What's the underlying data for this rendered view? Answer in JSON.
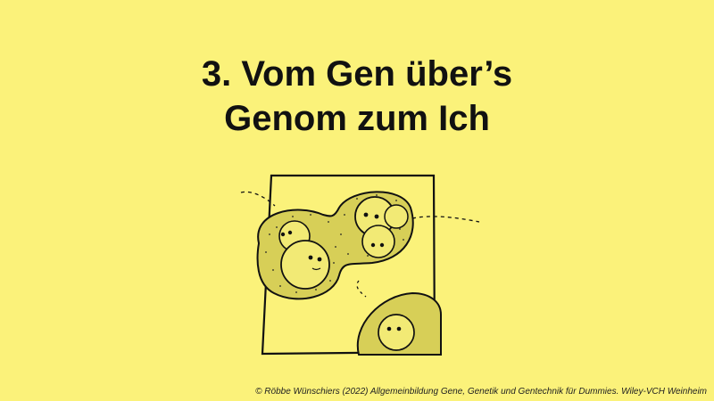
{
  "slide": {
    "title_line1": "3. Vom Gen über’s",
    "title_line2": "Genom zum Ich",
    "footer": "© Röbbe Wünschiers (2022) Allgemeinbildung Gene, Genetik und Gentechnik für Dummies. Wiley-VCH Weinheim"
  },
  "illustration": {
    "subject": "cell-division-illustration",
    "colors": {
      "background": "#fbf27a",
      "ink": "#111111",
      "cytoplasm": "#d7cf57",
      "nucleus": "#f2ea75"
    }
  }
}
